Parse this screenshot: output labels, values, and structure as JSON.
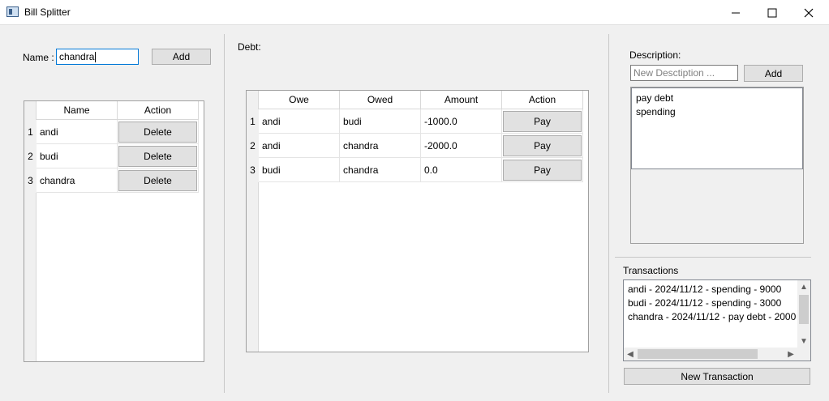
{
  "window": {
    "title": "Bill Splitter",
    "minimize_icon": "minimize-icon",
    "maximize_icon": "maximize-icon",
    "close_icon": "close-icon"
  },
  "people": {
    "name_label": "Name :",
    "name_value": "chandra",
    "add_label": "Add",
    "headers": [
      "Name",
      "Action"
    ],
    "rows": [
      {
        "num": "1",
        "name": "andi",
        "action": "Delete"
      },
      {
        "num": "2",
        "name": "budi",
        "action": "Delete"
      },
      {
        "num": "3",
        "name": "chandra",
        "action": "Delete"
      }
    ]
  },
  "debt": {
    "label": "Debt:",
    "headers": [
      "Owe",
      "Owed",
      "Amount",
      "Action"
    ],
    "rows": [
      {
        "num": "1",
        "owe": "andi",
        "owed": "budi",
        "amount": "-1000.0",
        "action": "Pay"
      },
      {
        "num": "2",
        "owe": "andi",
        "owed": "chandra",
        "amount": "-2000.0",
        "action": "Pay"
      },
      {
        "num": "3",
        "owe": "budi",
        "owed": "chandra",
        "amount": "0.0",
        "action": "Pay"
      }
    ]
  },
  "description": {
    "label": "Description:",
    "placeholder": "New Desctiption ...",
    "add_label": "Add",
    "items": [
      "pay debt",
      "spending"
    ]
  },
  "transactions": {
    "label": "Transactions",
    "items": [
      "andi - 2024/11/12 - spending - 9000",
      "budi - 2024/11/12 - spending - 3000",
      "chandra - 2024/11/12 - pay debt - 2000"
    ],
    "new_label": "New Transaction"
  }
}
